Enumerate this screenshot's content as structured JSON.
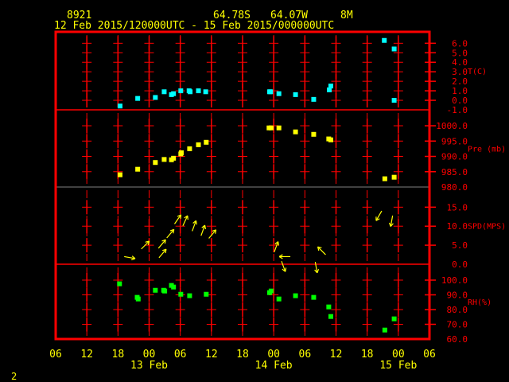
{
  "header": {
    "station": "8921",
    "lat": "64.78S",
    "lon": "64.07W",
    "elev": "8M",
    "range": "12 Feb 2015/120000UTC - 15 Feb 2015/000000UTC"
  },
  "footer_label": "2",
  "colors": {
    "axis": "#ff0000",
    "text": "#ffff00",
    "temp": "#00ffff",
    "pressure": "#ffff00",
    "wind": "#ffff00",
    "rh": "#00ff00",
    "divider": "#808080"
  },
  "chart_data": {
    "type": "scatter",
    "x_range": [
      "2015-02-12T06:00",
      "2015-02-15T06:00"
    ],
    "x_tick_labels": [
      "06",
      "12",
      "18",
      "00",
      "06",
      "12",
      "18",
      "00",
      "06",
      "12",
      "18",
      "00",
      "06"
    ],
    "x_day_labels": [
      {
        "time": "2015-02-13T00:00",
        "label": "13 Feb"
      },
      {
        "time": "2015-02-14T00:00",
        "label": "14 Feb"
      },
      {
        "time": "2015-02-15T00:00",
        "label": "15 Feb"
      }
    ],
    "panels": [
      {
        "key": "temp",
        "label": "T(C)",
        "ylim": [
          -1.0,
          7.2
        ],
        "ticks": [
          "6.0",
          "5.0",
          "4.0",
          "3.0",
          "2.0",
          "1.0",
          "0.0",
          "-1.0"
        ],
        "tick_values": [
          6,
          5,
          4,
          3,
          2,
          1,
          0,
          -1
        ],
        "points": [
          [
            "2015-02-12T18:24",
            -0.6
          ],
          [
            "2015-02-12T21:48",
            0.2
          ],
          [
            "2015-02-13T01:12",
            0.3
          ],
          [
            "2015-02-13T02:54",
            0.9
          ],
          [
            "2015-02-13T04:18",
            0.6
          ],
          [
            "2015-02-13T04:42",
            0.7
          ],
          [
            "2015-02-13T06:06",
            1.0
          ],
          [
            "2015-02-13T07:42",
            1.0
          ],
          [
            "2015-02-13T07:54",
            0.9
          ],
          [
            "2015-02-13T09:30",
            1.0
          ],
          [
            "2015-02-13T10:54",
            0.9
          ],
          [
            "2015-02-13T23:12",
            0.9
          ],
          [
            "2015-02-13T23:24",
            0.9
          ],
          [
            "2015-02-14T01:00",
            0.7
          ],
          [
            "2015-02-14T04:12",
            0.6
          ],
          [
            "2015-02-14T07:42",
            0.1
          ],
          [
            "2015-02-14T10:42",
            1.1
          ],
          [
            "2015-02-14T11:00",
            1.5
          ],
          [
            "2015-02-14T21:18",
            6.3
          ],
          [
            "2015-02-14T23:12",
            5.4
          ],
          [
            "2015-02-14T23:12",
            0.0
          ]
        ]
      },
      {
        "key": "pressure",
        "label": "Pre (mb)",
        "ylim": [
          980.0,
          1005.2
        ],
        "ticks": [
          "1000.0",
          "995.0",
          "990.0",
          "985.0",
          "980.0"
        ],
        "tick_values": [
          1000,
          995,
          990,
          985,
          980
        ],
        "points": [
          [
            "2015-02-12T18:24",
            984.0
          ],
          [
            "2015-02-12T21:48",
            985.8
          ],
          [
            "2015-02-13T01:12",
            988.0
          ],
          [
            "2015-02-13T02:54",
            989.0
          ],
          [
            "2015-02-13T04:18",
            988.9
          ],
          [
            "2015-02-13T04:42",
            989.4
          ],
          [
            "2015-02-13T06:06",
            990.8
          ],
          [
            "2015-02-13T06:12",
            991.2
          ],
          [
            "2015-02-13T07:48",
            992.5
          ],
          [
            "2015-02-13T09:30",
            993.8
          ],
          [
            "2015-02-13T11:00",
            994.6
          ],
          [
            "2015-02-13T23:06",
            999.3
          ],
          [
            "2015-02-13T23:30",
            999.3
          ],
          [
            "2015-02-14T01:00",
            999.3
          ],
          [
            "2015-02-14T04:12",
            998.0
          ],
          [
            "2015-02-14T07:42",
            997.2
          ],
          [
            "2015-02-14T10:36",
            995.7
          ],
          [
            "2015-02-14T11:00",
            995.4
          ],
          [
            "2015-02-14T21:24",
            982.7
          ],
          [
            "2015-02-14T23:12",
            983.2
          ]
        ]
      },
      {
        "key": "wind",
        "label": "SPD(MPS)",
        "ylim": [
          0.0,
          20.3
        ],
        "ticks": [
          "15.0",
          "10.0",
          "5.0",
          "0.0"
        ],
        "tick_values": [
          15,
          10,
          5,
          0
        ],
        "points": [
          [
            "2015-02-12T19:12",
            2.0,
            100
          ],
          [
            "2015-02-12T22:30",
            4.0,
            45
          ],
          [
            "2015-02-13T01:48",
            4.2,
            40
          ],
          [
            "2015-02-13T01:54",
            1.7,
            40
          ],
          [
            "2015-02-13T03:24",
            6.9,
            40
          ],
          [
            "2015-02-13T04:54",
            10.6,
            35
          ],
          [
            "2015-02-13T06:30",
            10.1,
            25
          ],
          [
            "2015-02-13T08:18",
            8.7,
            20
          ],
          [
            "2015-02-13T10:00",
            7.5,
            20
          ],
          [
            "2015-02-13T11:30",
            6.8,
            40
          ],
          [
            "2015-02-14T00:06",
            3.2,
            20
          ],
          [
            "2015-02-14T01:30",
            0.8,
            160
          ],
          [
            "2015-02-14T03:12",
            2.0,
            270
          ],
          [
            "2015-02-14T08:00",
            0.6,
            170
          ],
          [
            "2015-02-14T10:00",
            2.5,
            315
          ],
          [
            "2015-02-14T20:48",
            14.0,
            210
          ],
          [
            "2015-02-14T22:54",
            12.8,
            190
          ]
        ]
      },
      {
        "key": "rh",
        "label": "RH(%)",
        "ylim": [
          60.0,
          110.8
        ],
        "ticks": [
          "100.0",
          "90.0",
          "80.0",
          "70.0",
          "60.0"
        ],
        "tick_values": [
          100,
          90,
          80,
          70,
          60
        ],
        "points": [
          [
            "2015-02-12T18:18",
            97.5
          ],
          [
            "2015-02-12T21:42",
            88.3
          ],
          [
            "2015-02-12T21:54",
            87.2
          ],
          [
            "2015-02-13T01:12",
            93.1
          ],
          [
            "2015-02-13T02:48",
            93.1
          ],
          [
            "2015-02-13T03:00",
            92.6
          ],
          [
            "2015-02-13T04:18",
            96.4
          ],
          [
            "2015-02-13T04:42",
            95.3
          ],
          [
            "2015-02-13T06:06",
            90.4
          ],
          [
            "2015-02-13T07:48",
            89.4
          ],
          [
            "2015-02-13T11:00",
            90.4
          ],
          [
            "2015-02-13T23:12",
            91.5
          ],
          [
            "2015-02-13T23:30",
            92.6
          ],
          [
            "2015-02-14T01:00",
            87.2
          ],
          [
            "2015-02-14T04:12",
            89.4
          ],
          [
            "2015-02-14T07:42",
            88.3
          ],
          [
            "2015-02-14T10:36",
            81.8
          ],
          [
            "2015-02-14T11:00",
            75.3
          ],
          [
            "2015-02-14T21:24",
            66.1
          ],
          [
            "2015-02-14T23:12",
            73.7
          ]
        ]
      }
    ]
  }
}
